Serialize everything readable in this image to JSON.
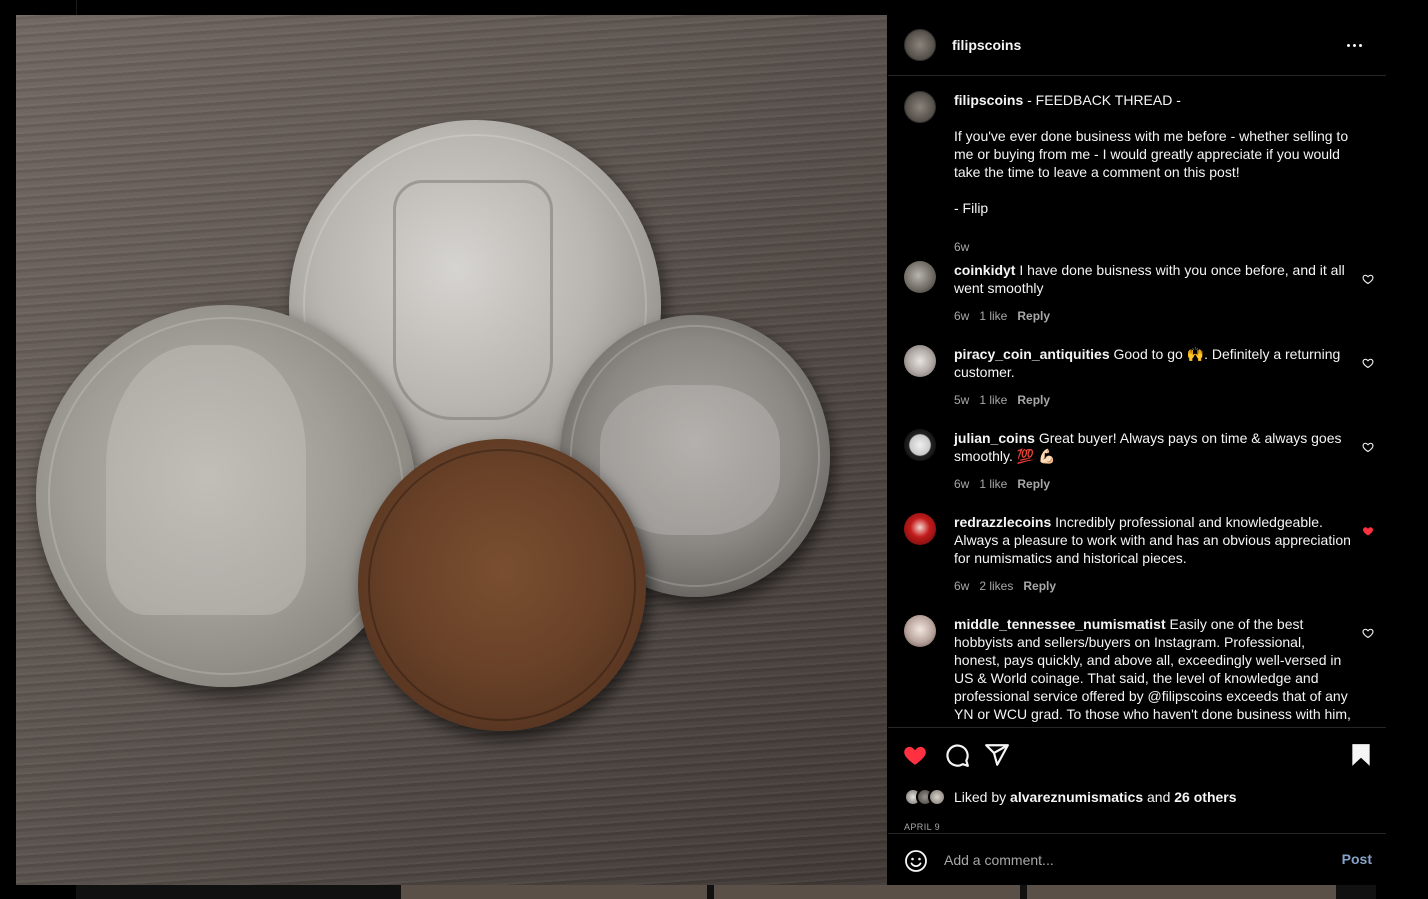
{
  "post": {
    "username": "filipscoins",
    "image_alt": "four coins on a wood table"
  },
  "caption": {
    "username": "filipscoins",
    "text": "- FEEDBACK THREAD -\n\nIf you've ever done business with me before - whether selling to me or buying from me - I would greatly appreciate if you would take the time to leave a comment on this post!\n\n- Filip",
    "time": "6w"
  },
  "comments": [
    {
      "username": "coinkidyt",
      "text": "I have done buisness with you once before, and it all went smoothly",
      "time": "6w",
      "likes": "1 like",
      "reply": "Reply",
      "liked": false
    },
    {
      "username": "piracy_coin_antiquities",
      "text": "Good to go 🙌. Definitely a returning customer.",
      "time": "5w",
      "likes": "1 like",
      "reply": "Reply",
      "liked": false
    },
    {
      "username": "julian_coins",
      "text": "Great buyer! Always pays on time & always goes smoothly. 💯 💪🏻",
      "time": "6w",
      "likes": "1 like",
      "reply": "Reply",
      "liked": false
    },
    {
      "username": "redrazzlecoins",
      "text": "Incredibly professional and knowledgeable. Always a pleasure to work with and has an obvious appreciation for numismatics and historical pieces.",
      "time": "6w",
      "likes": "2 likes",
      "reply": "Reply",
      "liked": true
    },
    {
      "username": "middle_tennessee_numismatist",
      "text": "Easily one of the best hobbyists and sellers/buyers on Instagram. Professional, honest, pays quickly, and above all, exceedingly well-versed in US & World coinage. That said, the level of knowledge and professional service offered by @filipscoins exceeds that of any YN or WCU grad. To those who haven't done business with him, I implore",
      "liked": false
    }
  ],
  "likes": {
    "prefix": "Liked by",
    "user": "alvareznumismatics",
    "middle": "and",
    "others": "26 others"
  },
  "date": "APRIL 9",
  "add_comment": {
    "placeholder": "Add a comment...",
    "post_label": "Post"
  },
  "icons": {
    "like": "heart-filled-icon",
    "comment": "comment-icon",
    "share": "paper-plane-icon",
    "save": "bookmark-filled-icon",
    "more": "more-horizontal-icon",
    "emoji": "emoji-icon"
  },
  "colors": {
    "background": "#000000",
    "like_red": "#ff3040",
    "post_button": "#85a3c8",
    "secondary_text": "#a8a8a8"
  }
}
